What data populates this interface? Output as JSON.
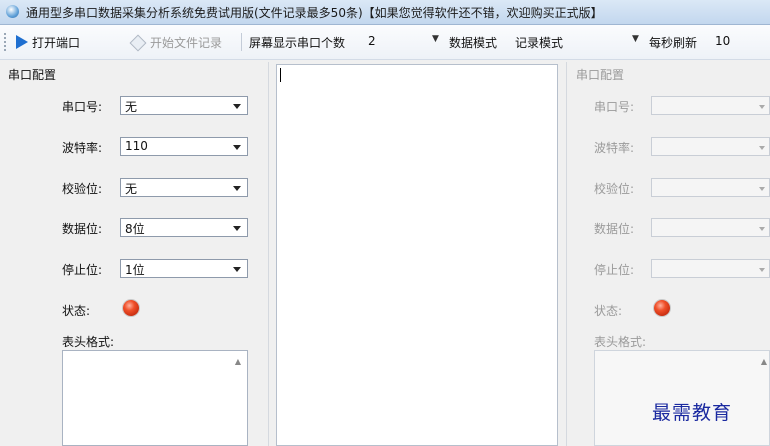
{
  "window": {
    "title": "通用型多串口数据采集分析系统免费试用版(文件记录最多50条)【如果您觉得软件还不错，欢迎购买正式版】"
  },
  "toolbar": {
    "open_port_label": "打开端口",
    "start_record_label": "开始文件记录",
    "screen_ports_label": "屏幕显示串口个数",
    "screen_ports_value": "2",
    "data_mode_label": "数据模式",
    "data_mode_value": "记录模式",
    "refresh_label": "每秒刷新",
    "refresh_value": "10"
  },
  "left_panel": {
    "title": "串口配置",
    "port_label": "串口号:",
    "port_value": "无",
    "baud_label": "波特率:",
    "baud_value": "110",
    "parity_label": "校验位:",
    "parity_value": "无",
    "databits_label": "数据位:",
    "databits_value": "8位",
    "stopbits_label": "停止位:",
    "stopbits_value": "1位",
    "status_label": "状态:",
    "header_format_label": "表头格式:"
  },
  "right_panel": {
    "title": "串口配置",
    "port_label": "串口号:",
    "baud_label": "波特率:",
    "parity_label": "校验位:",
    "databits_label": "数据位:",
    "stopbits_label": "停止位:",
    "status_label": "状态:",
    "header_format_label": "表头格式:"
  },
  "icons": {
    "open_port": "play-icon",
    "start_record": "record-icon",
    "status_led": "red-led-icon"
  },
  "colors": {
    "accent": "#1f6fd0",
    "status_led": "#e8461f",
    "watermark": "#1b2aa0"
  },
  "watermark": "最需教育"
}
